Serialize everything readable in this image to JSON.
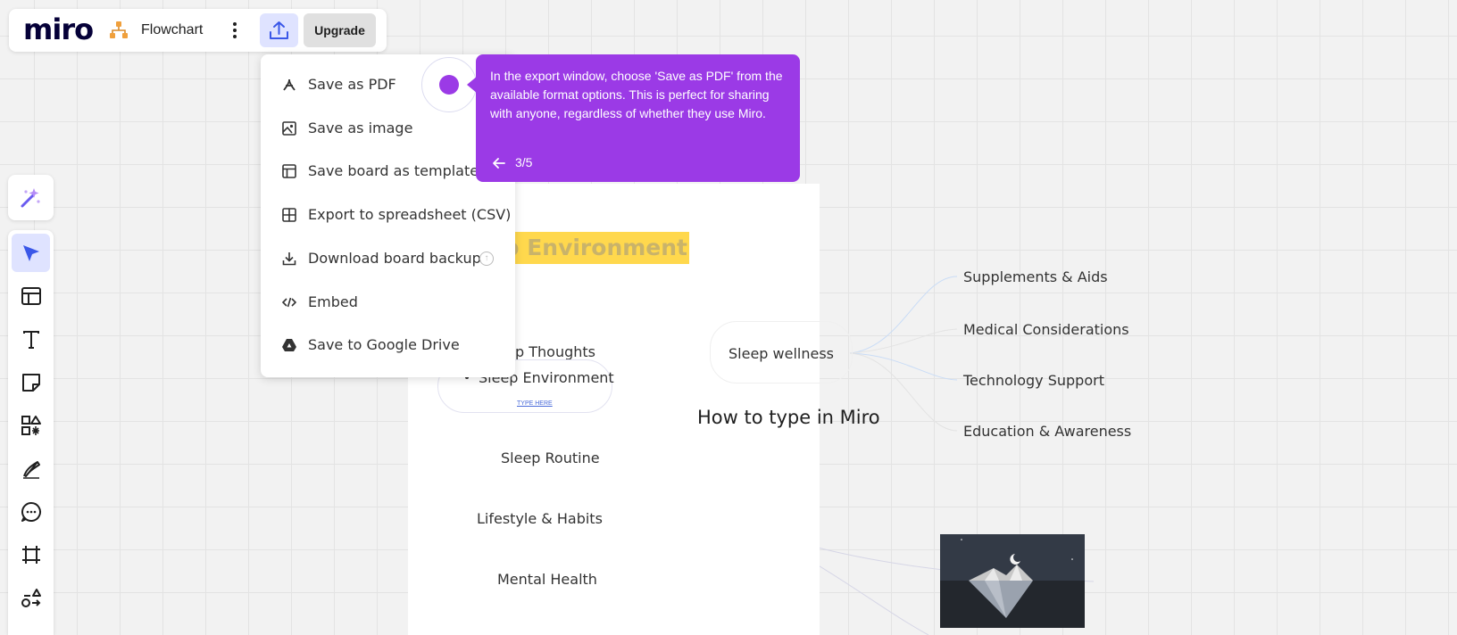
{
  "header": {
    "logo": "miro",
    "board_title": "Flowchart",
    "upgrade_label": "Upgrade"
  },
  "toolbar": {
    "items": [
      "ai-assist-icon",
      "select-cursor-icon",
      "templates-icon",
      "text-icon",
      "sticky-note-icon",
      "shapes-icon",
      "pen-icon",
      "comment-icon",
      "frame-icon",
      "more-tools-icon"
    ],
    "active": "select-cursor-icon",
    "accent": "#4262ff"
  },
  "export_menu": {
    "items": [
      {
        "label": "Save as PDF",
        "icon": "pdf-icon"
      },
      {
        "label": "Save as image",
        "icon": "image-icon"
      },
      {
        "label": "Save board as template",
        "icon": "template-icon"
      },
      {
        "label": "Export to spreadsheet (CSV)",
        "icon": "table-icon"
      },
      {
        "label": "Download board backup",
        "icon": "download-icon"
      },
      {
        "label": "Embed",
        "icon": "embed-icon"
      },
      {
        "label": "Save to Google Drive",
        "icon": "google-drive-icon"
      }
    ]
  },
  "tour": {
    "text": "In the export window, choose 'Save as PDF' from the available format options. This is perfect for sharing with anyone, regardless of whether they use Miro.",
    "step": "3/5",
    "color": "#9b3ae6"
  },
  "canvas": {
    "frame_title": "ep Environment",
    "main_topic": "How to type in Miro",
    "left_nodes": [
      "p Thoughts",
      "Sleep Environment",
      "Sleep Routine",
      "Lifestyle & Habits",
      "Mental Health"
    ],
    "type_here": "TYPE HERE",
    "center_node": "Sleep wellness",
    "right_nodes": [
      "Supplements & Aids",
      "Medical Considerations",
      "Technology Support",
      "Education & Awareness"
    ]
  }
}
